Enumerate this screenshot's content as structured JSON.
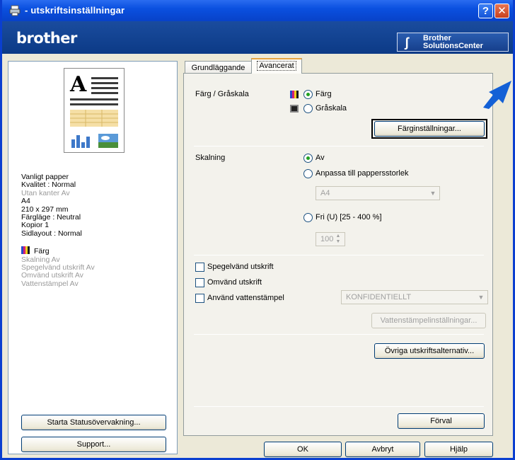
{
  "window": {
    "title": "- utskriftsinställningar",
    "help_label": "?",
    "close_label": "✕"
  },
  "brand": {
    "logo": "brother",
    "solutions_line1": "Brother",
    "solutions_line2": "SolutionsCenter"
  },
  "preview_letter": "A",
  "settings_summary": [
    {
      "text": "Vanligt papper",
      "style": "normal"
    },
    {
      "text": "Kvalitet : Normal",
      "style": "normal"
    },
    {
      "text": "Utan kanter Av",
      "style": "gray"
    },
    {
      "text": "A4",
      "style": "normal"
    },
    {
      "text": "210 x 297 mm",
      "style": "normal"
    },
    {
      "text": "Färgläge : Neutral",
      "style": "normal"
    },
    {
      "text": "Kopior 1",
      "style": "normal"
    },
    {
      "text": "Sidlayout : Normal",
      "style": "normal"
    }
  ],
  "color_summary": "Färg",
  "advanced_summary": [
    "Skalning Av",
    "Spegelvänd utskrift Av",
    "Omvänd utskrift Av",
    "Vattenstämpel Av"
  ],
  "left_buttons": {
    "status": "Starta Statusövervakning...",
    "support": "Support..."
  },
  "tabs": {
    "basic": "Grundläggande",
    "advanced": "Avancerat"
  },
  "color_section": {
    "label": "Färg / Gråskala",
    "option_color": "Färg",
    "option_gray": "Gråskala",
    "selected": "Färg",
    "settings_button": "Färginställningar..."
  },
  "scaling_section": {
    "label": "Skalning",
    "option_off": "Av",
    "option_fit": "Anpassa till pappersstorlek",
    "paper_size_value": "A4",
    "option_free": "Fri (U) [25 - 400 %]",
    "free_value": "100",
    "selected": "Av"
  },
  "checkboxes": {
    "mirror": "Spegelvänd utskrift",
    "reverse": "Omvänd utskrift",
    "watermark": "Använd vattenstämpel"
  },
  "watermark": {
    "value": "KONFIDENTIELLT",
    "settings_button": "Vattenstämpelinställningar..."
  },
  "other_options_button": "Övriga utskriftsalternativ...",
  "default_button": "Förval",
  "dialog_buttons": {
    "ok": "OK",
    "cancel": "Avbryt",
    "help": "Hjälp"
  },
  "colors": {
    "title_blue": "#0a50e0",
    "brand_blue": "#0c3a86",
    "dialog_bg": "#ece9d8",
    "accent_arrow": "#1360d6"
  }
}
